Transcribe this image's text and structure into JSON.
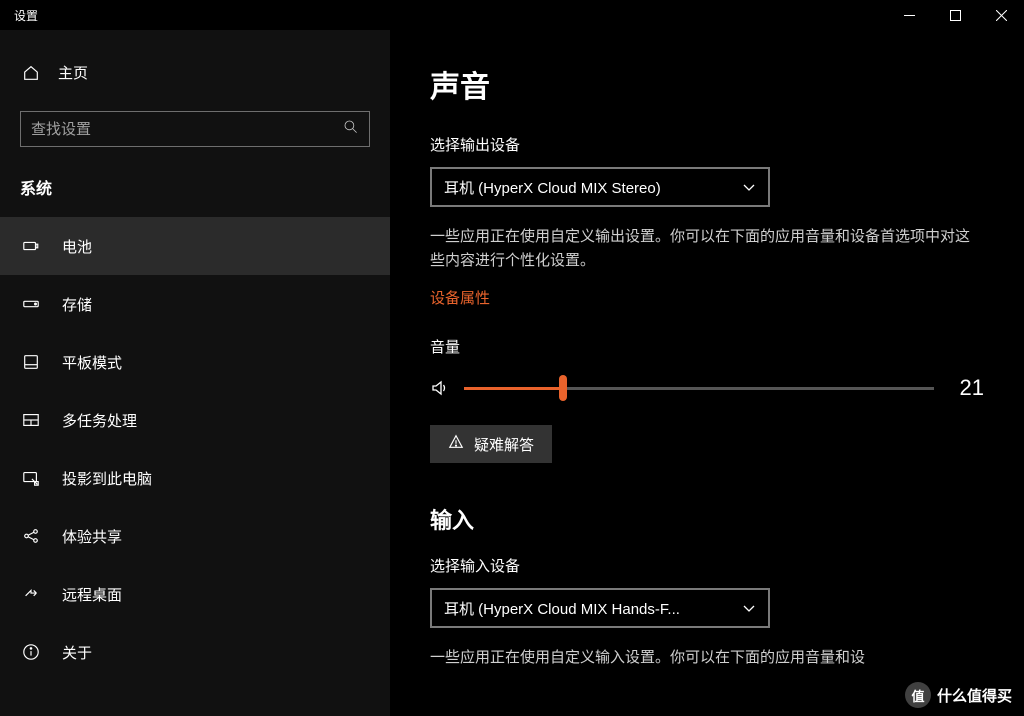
{
  "window": {
    "title": "设置"
  },
  "sidebar": {
    "home": "主页",
    "search_placeholder": "查找设置",
    "section": "系统",
    "items": [
      {
        "label": "电池",
        "icon": "battery",
        "active": true
      },
      {
        "label": "存储",
        "icon": "storage",
        "active": false
      },
      {
        "label": "平板模式",
        "icon": "tablet",
        "active": false
      },
      {
        "label": "多任务处理",
        "icon": "multitask",
        "active": false
      },
      {
        "label": "投影到此电脑",
        "icon": "project",
        "active": false
      },
      {
        "label": "体验共享",
        "icon": "share",
        "active": false
      },
      {
        "label": "远程桌面",
        "icon": "remote",
        "active": false
      },
      {
        "label": "关于",
        "icon": "about",
        "active": false
      }
    ]
  },
  "main": {
    "title": "声音",
    "output": {
      "label": "选择输出设备",
      "selected": "耳机 (HyperX Cloud MIX Stereo)",
      "desc": "一些应用正在使用自定义输出设置。你可以在下面的应用音量和设备首选项中对这些内容进行个性化设置。",
      "properties_link": "设备属性"
    },
    "volume": {
      "label": "音量",
      "value": 21,
      "percent": 21
    },
    "troubleshoot": "疑难解答",
    "input": {
      "heading": "输入",
      "label": "选择输入设备",
      "selected": "耳机 (HyperX Cloud MIX Hands-F...",
      "desc": "一些应用正在使用自定义输入设置。你可以在下面的应用音量和设"
    }
  },
  "watermark": {
    "badge": "值",
    "text": "什么值得买"
  }
}
